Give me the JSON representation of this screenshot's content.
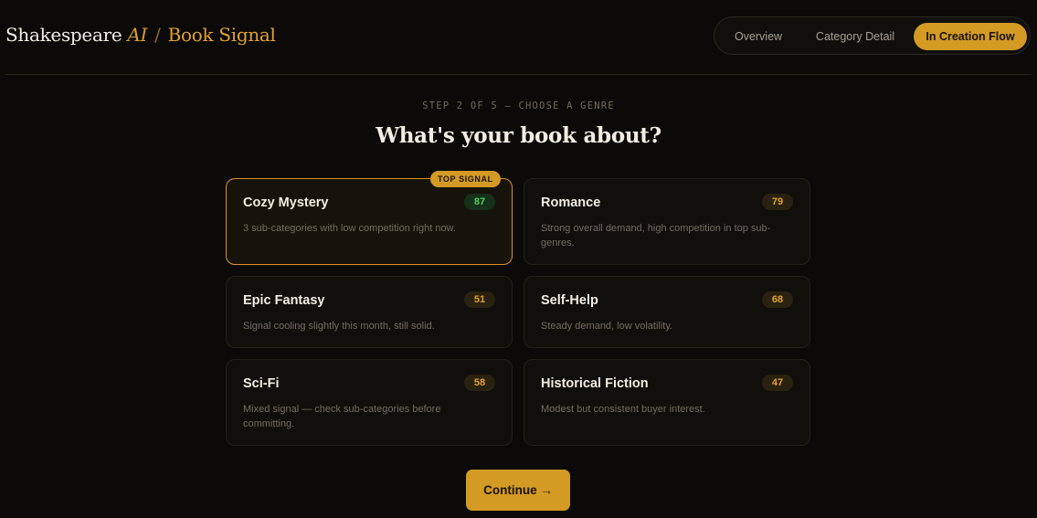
{
  "brand": {
    "name": "Shakespeare",
    "ai": "AI",
    "separator": "/",
    "product": "Book Signal"
  },
  "nav": {
    "tabs": [
      {
        "label": "Overview",
        "active": false
      },
      {
        "label": "Category Detail",
        "active": false
      },
      {
        "label": "In Creation Flow",
        "active": true
      }
    ]
  },
  "wizard": {
    "step": "STEP 2 OF 5 — CHOOSE A GENRE",
    "title": "What's your book about?",
    "continue_label": "Continue →"
  },
  "genres": [
    {
      "name": "Cozy Mystery",
      "score": "87",
      "description": "3 sub-categories with low competition right now.",
      "badge": "TOP SIGNAL",
      "selected": true,
      "score_color": "#4fcf63"
    },
    {
      "name": "Romance",
      "score": "79",
      "description": "Strong overall demand, high competition in top sub-genres.",
      "selected": false,
      "score_color": "#e3a12e"
    },
    {
      "name": "Epic Fantasy",
      "score": "51",
      "description": "Signal cooling slightly this month, still solid.",
      "selected": false,
      "score_color": "#e3a12e"
    },
    {
      "name": "Self-Help",
      "score": "68",
      "description": "Steady demand, low volatility.",
      "selected": false,
      "score_color": "#e3a12e"
    },
    {
      "name": "Sci-Fi",
      "score": "58",
      "description": "Mixed signal — check sub-categories before committing.",
      "selected": false,
      "score_color": "#e3a12e"
    },
    {
      "name": "Historical Fiction",
      "score": "47",
      "description": "Modest but consistent buyer interest.",
      "selected": false,
      "score_color": "#e3a12e"
    }
  ],
  "colors": {
    "background": "#0b0a08",
    "accent": "#d39a24",
    "selected_border": "#d9912c",
    "positive": "#4fcf63"
  }
}
